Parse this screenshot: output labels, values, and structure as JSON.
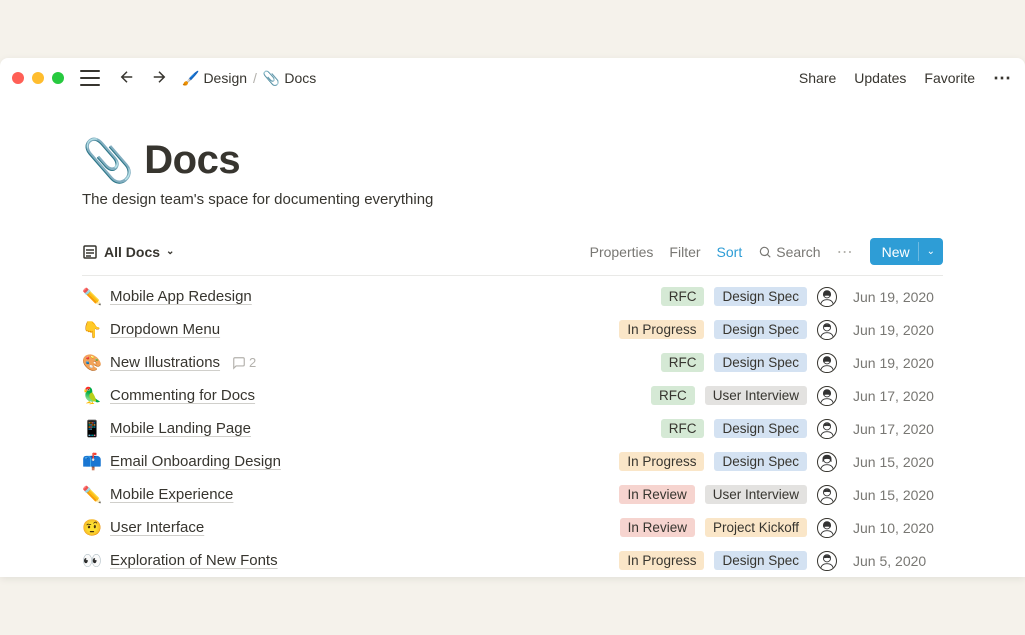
{
  "breadcrumb": {
    "parent_icon": "🖌️",
    "parent_label": "Design",
    "current_icon": "📎",
    "current_label": "Docs"
  },
  "topbar": {
    "share": "Share",
    "updates": "Updates",
    "favorite": "Favorite"
  },
  "page": {
    "icon": "📎",
    "title": "Docs",
    "subtitle": "The design team's space for documenting everything"
  },
  "view": {
    "name": "All Docs",
    "properties": "Properties",
    "filter": "Filter",
    "sort": "Sort",
    "search": "Search",
    "new": "New"
  },
  "tags": {
    "rfc": "RFC",
    "in_progress": "In Progress",
    "in_review": "In Review",
    "design_spec": "Design Spec",
    "user_interview": "User Interview",
    "project_kickoff": "Project Kickoff"
  },
  "docs": [
    {
      "icon": "✏️",
      "title": "Mobile App Redesign",
      "status": "rfc",
      "type": "design_spec",
      "avatar": 0,
      "date": "Jun 19, 2020"
    },
    {
      "icon": "👇",
      "title": "Dropdown Menu",
      "status": "in_progress",
      "type": "design_spec",
      "avatar": 1,
      "date": "Jun 19, 2020"
    },
    {
      "icon": "🎨",
      "title": "New Illustrations",
      "status": "rfc",
      "type": "design_spec",
      "avatar": 0,
      "date": "Jun 19, 2020",
      "comments": "2"
    },
    {
      "icon": "🦜",
      "title": "Commenting for Docs",
      "status": "rfc",
      "type": "user_interview",
      "avatar": 0,
      "date": "Jun 17, 2020"
    },
    {
      "icon": "📱",
      "title": "Mobile Landing Page",
      "status": "rfc",
      "type": "design_spec",
      "avatar": 1,
      "date": "Jun 17, 2020"
    },
    {
      "icon": "📫",
      "title": "Email Onboarding Design",
      "status": "in_progress",
      "type": "design_spec",
      "avatar": 2,
      "date": "Jun 15, 2020"
    },
    {
      "icon": "✏️",
      "title": "Mobile Experience",
      "status": "in_review",
      "type": "user_interview",
      "avatar": 1,
      "date": "Jun 15, 2020"
    },
    {
      "icon": "🤨",
      "title": "User Interface",
      "status": "in_review",
      "type": "project_kickoff",
      "avatar": 0,
      "date": "Jun 10, 2020"
    },
    {
      "icon": "👀",
      "title": "Exploration of New Fonts",
      "status": "in_progress",
      "type": "design_spec",
      "avatar": 1,
      "date": "Jun 5, 2020"
    }
  ]
}
